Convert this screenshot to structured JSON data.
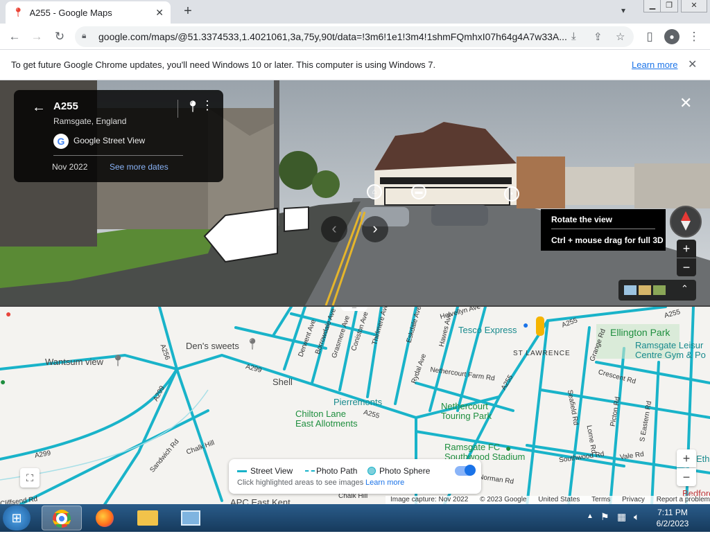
{
  "browser": {
    "tab_title": "A255 - Google Maps",
    "url": "google.com/maps/@51.3374533,1.4021061,3a,75y,90t/data=!3m6!1e1!3m4!1shmFQmhxI07h64g4A7w33A..."
  },
  "infobar": {
    "message": "To get future Google Chrome updates, you'll need Windows 10 or later. This computer is using Windows 7.",
    "link": "Learn more"
  },
  "streetview": {
    "road": "A255",
    "place": "Ramsgate, England",
    "source": "Google Street View",
    "date": "Nov 2022",
    "more_dates": "See more dates",
    "tooltip_line1": "Rotate the view",
    "tooltip_line2": "Ctrl + mouse drag for full 3D",
    "zoom_in": "+",
    "zoom_out": "−"
  },
  "map": {
    "labels": {
      "dens_sweets": "Den's sweets",
      "wantsum": "Wantsum view",
      "shell": "Shell",
      "pierremonts": "Pierremonts",
      "chilton": "Chilton Lane\nEast Allotments",
      "nethercourt": "Nethercourt\nTouring Park",
      "ramsgate_fc": "Ramsgate FC\nSouthwood Stadium",
      "apc": "APC East Kent",
      "tesco": "Tesco Express",
      "st_lawrence": "ST LAWRENCE",
      "ellington": "Ellington Park",
      "leisure": "Ramsgate Leisur\nCentre Gym & Po",
      "a299_1": "A299",
      "a299_2": "A299",
      "a299_3": "A299",
      "a256": "A256",
      "a255_1": "A255",
      "a255_2": "A255",
      "a255_3": "A255",
      "a255_4": "A255",
      "sandwich_rd": "Sandwich Rd",
      "chalk_hill": "Chalk Hill",
      "nethercourt_farm": "Nethercourt Farm Rd",
      "derwent": "Derwent Ave",
      "borrowdale": "Borrowdale Ave",
      "grasmere": "Grasmere Ave",
      "coniston": "Coniston Ave",
      "thirlmere": "Thirlmere Ave",
      "eskdale": "Eskdale Ave",
      "hawes": "Hawes Ave",
      "helvellyn": "Helvellyn Ave",
      "rydal": "Rydal Ave",
      "seafield": "Seafield Rd",
      "grange": "Grange Rd",
      "crescent": "Crescent Rd",
      "picton": "Picton Rd",
      "s_eastern": "S Eastern Rd",
      "lorne": "Lorne Rd",
      "southwood": "Southwood Rd",
      "vale": "Vale Rd",
      "norman": "Norman Rd",
      "cliffsend": "Cliffsend Rd",
      "bedford": "Bedford",
      "ethe": "Ethe"
    },
    "legend": {
      "street_view": "Street View",
      "photo_path": "Photo Path",
      "photo_sphere": "Photo Sphere",
      "hint": "Click highlighted areas to see images",
      "learn_more": "Learn more"
    },
    "attribution": [
      "Image capture: Nov 2022",
      "© 2023 Google",
      "United States",
      "Terms",
      "Privacy",
      "Report a problem"
    ],
    "zoom_in": "+",
    "zoom_out": "−"
  },
  "taskbar": {
    "time": "7:11 PM",
    "date": "6/2/2023"
  },
  "colors": {
    "road_highlight": "#19b3c9",
    "map_bg": "#f4f3f0",
    "accent": "#1a73e8"
  }
}
